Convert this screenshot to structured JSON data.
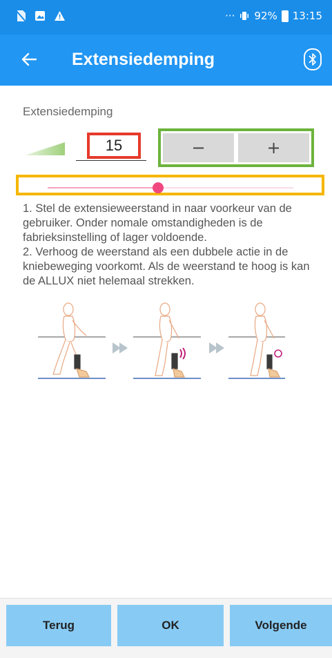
{
  "status_bar": {
    "left_icons": [
      "no-sim-icon",
      "image-icon",
      "warning-icon"
    ],
    "dots": "···",
    "signal_icon": "vibrate-icon",
    "battery": "92%",
    "time": "13:15"
  },
  "app_bar": {
    "back_icon": "arrow-left-icon",
    "title": "Extensiedemping",
    "bluetooth_icon": "bluetooth-icon"
  },
  "setting": {
    "label": "Extensiedemping",
    "value": "15",
    "decrement_label": "−",
    "increment_label": "+",
    "slider_level_fraction": 0.45
  },
  "instructions": [
    "1. Stel de extensieweerstand in naar voorkeur van de gebruiker. Onder nomale omstandigheden is de fabrieksinstelling of lager voldoende.",
    "2. Verhoog de weerstand als een dubbele actie in de kniebeweging voorkomt. Als de weerstand te hoog is kan de ALLUX niet helemaal strekken."
  ],
  "colors": {
    "status_bar": "#1a8de9",
    "app_bar": "#2196f3",
    "value_border": "#e53a2b",
    "stepper_border": "#6cb33e",
    "slider_border": "#f5b700",
    "slider_thumb": "#f0477e",
    "footer_button": "#87cbf5"
  },
  "footer": {
    "back_label": "Terug",
    "ok_label": "OK",
    "next_label": "Volgende"
  }
}
